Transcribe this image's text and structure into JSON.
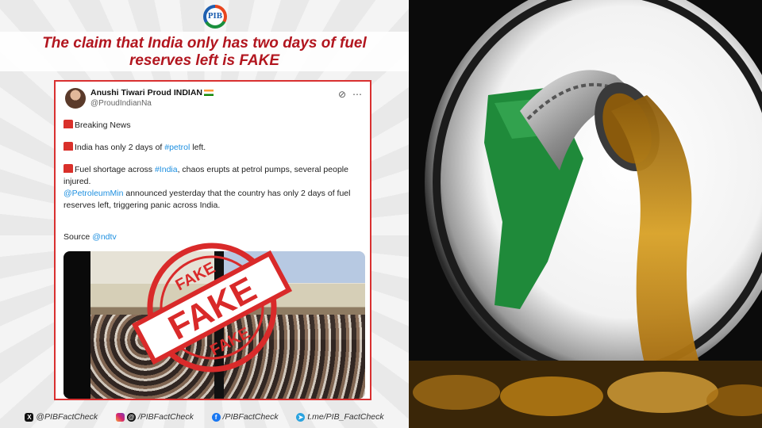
{
  "headline": "The claim that India only has two days of fuel reserves left is FAKE",
  "logo_text": "PIB",
  "tweet": {
    "display_name": "Anushi Tiwari Proud INDIAN",
    "handle": "@ProudIndianNa",
    "line1": "Breaking News",
    "line2_pre": "India has only 2 days of ",
    "line2_tag": "#petrol",
    "line2_post": " left.",
    "line3_pre": "Fuel shortage across ",
    "line3_tag": "#India",
    "line3_post": ", chaos erupts at petrol pumps, several people injured.",
    "line4_mention": "@PetroleumMin",
    "line4_post": " announced yesterday that the country has only 2 days of fuel reserves left, triggering panic across India.",
    "source_label": "Source ",
    "source_mention": "@ndtv"
  },
  "stamp_word": "FAKE",
  "footer": {
    "x": "@PIBFactCheck",
    "instagram": "/PIBFactCheck",
    "facebook": "/PIBFactCheck",
    "telegram": "t.me/PIB_FactCheck"
  },
  "colors": {
    "headline": "#b2161f",
    "stamp": "#d92a2a",
    "link": "#1d8fe0",
    "fuel": "#c98a16",
    "nozzle": "#1f8a3a"
  },
  "icons": [
    "x-icon",
    "instagram-icon",
    "threads-icon",
    "facebook-icon",
    "telegram-icon",
    "siren-icon",
    "grok-icon",
    "more-icon"
  ]
}
